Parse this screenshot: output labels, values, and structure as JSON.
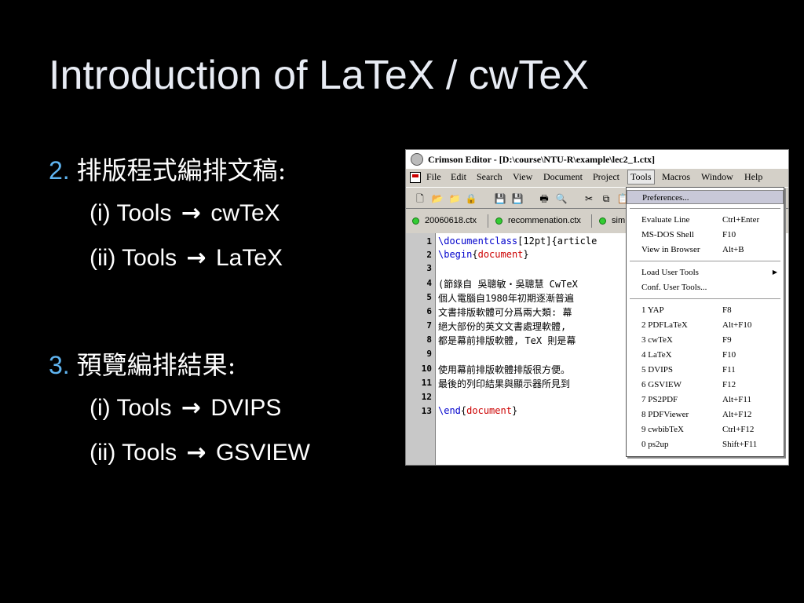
{
  "slide": {
    "title": "Introduction of LaTeX / cwTeX",
    "bullets": [
      {
        "number": "2.",
        "heading": "排版程式編排文稿:",
        "items": [
          {
            "prefix": "(i) Tools",
            "arrow": "→",
            "target": "cwTeX"
          },
          {
            "prefix": "(ii) Tools",
            "arrow": "→",
            "target": "LaTeX"
          }
        ]
      },
      {
        "number": "3.",
        "heading": "預覽編排結果:",
        "items": [
          {
            "prefix": "(i) Tools",
            "arrow": "→",
            "target": "DVIPS"
          },
          {
            "prefix": "(ii) Tools",
            "arrow": "→",
            "target": "GSVIEW"
          }
        ]
      }
    ]
  },
  "window": {
    "title": "Crimson Editor - [D:\\course\\NTU-R\\example\\lec2_1.ctx]",
    "menus": [
      "File",
      "Edit",
      "Search",
      "View",
      "Document",
      "Project",
      "Tools",
      "Macros",
      "Window",
      "Help"
    ],
    "active_menu": "Tools",
    "tabs": [
      "20060618.ctx",
      "recommenation.ctx",
      "sim"
    ],
    "line_numbers": [
      "1",
      "2",
      "3",
      "4",
      "5",
      "6",
      "7",
      "8",
      "9",
      "10",
      "11",
      "12",
      "13"
    ],
    "code": {
      "l1_cmd": "\\documentclass",
      "l1_opt": "[12pt]",
      "l1_arg_open": "{",
      "l1_arg": "article",
      "l2_cmd": "\\begin",
      "l2_open": "{",
      "l2_arg": "document",
      "l2_close": "}",
      "l4": "(節錄自 吳聰敏・吳聰慧 CwTeX",
      "l5": "個人電腦自1980年初期逐漸普遍",
      "l6": "文書排版軟體可分爲兩大類: 幕",
      "l7": "絕大部份的英文文書處理軟體,",
      "l8": "都是幕前排版軟體, TeX 則是幕",
      "l10": "使用幕前排版軟體排版很方便。",
      "l11": "最後的列印結果與顯示器所見到",
      "l13_cmd": "\\end",
      "l13_open": "{",
      "l13_arg": "document",
      "l13_close": "}"
    },
    "tools_menu": {
      "items": [
        {
          "label": "Preferences...",
          "key": ""
        },
        {
          "label": "Evaluate Line",
          "key": "Ctrl+Enter"
        },
        {
          "label": "MS-DOS Shell",
          "key": "F10"
        },
        {
          "label": "View in Browser",
          "key": "Alt+B"
        },
        {
          "label": "Load User Tools",
          "key": ""
        },
        {
          "label": "Conf. User Tools...",
          "key": ""
        },
        {
          "label": "1 YAP",
          "key": "F8"
        },
        {
          "label": "2 PDFLaTeX",
          "key": "Alt+F10"
        },
        {
          "label": "3 cwTeX",
          "key": "F9"
        },
        {
          "label": "4 LaTeX",
          "key": "F10"
        },
        {
          "label": "5 DVIPS",
          "key": "F11"
        },
        {
          "label": "6 GSVIEW",
          "key": "F12"
        },
        {
          "label": "7 PS2PDF",
          "key": "Alt+F11"
        },
        {
          "label": "8 PDFViewer",
          "key": "Alt+F12"
        },
        {
          "label": "9 cwbibTeX",
          "key": "Ctrl+F12"
        },
        {
          "label": "0 ps2up",
          "key": "Shift+F11"
        }
      ]
    },
    "colors": {
      "keyword": "#0000cc",
      "argument": "#cc0000",
      "bullet_number": "#5fb4f0"
    }
  }
}
